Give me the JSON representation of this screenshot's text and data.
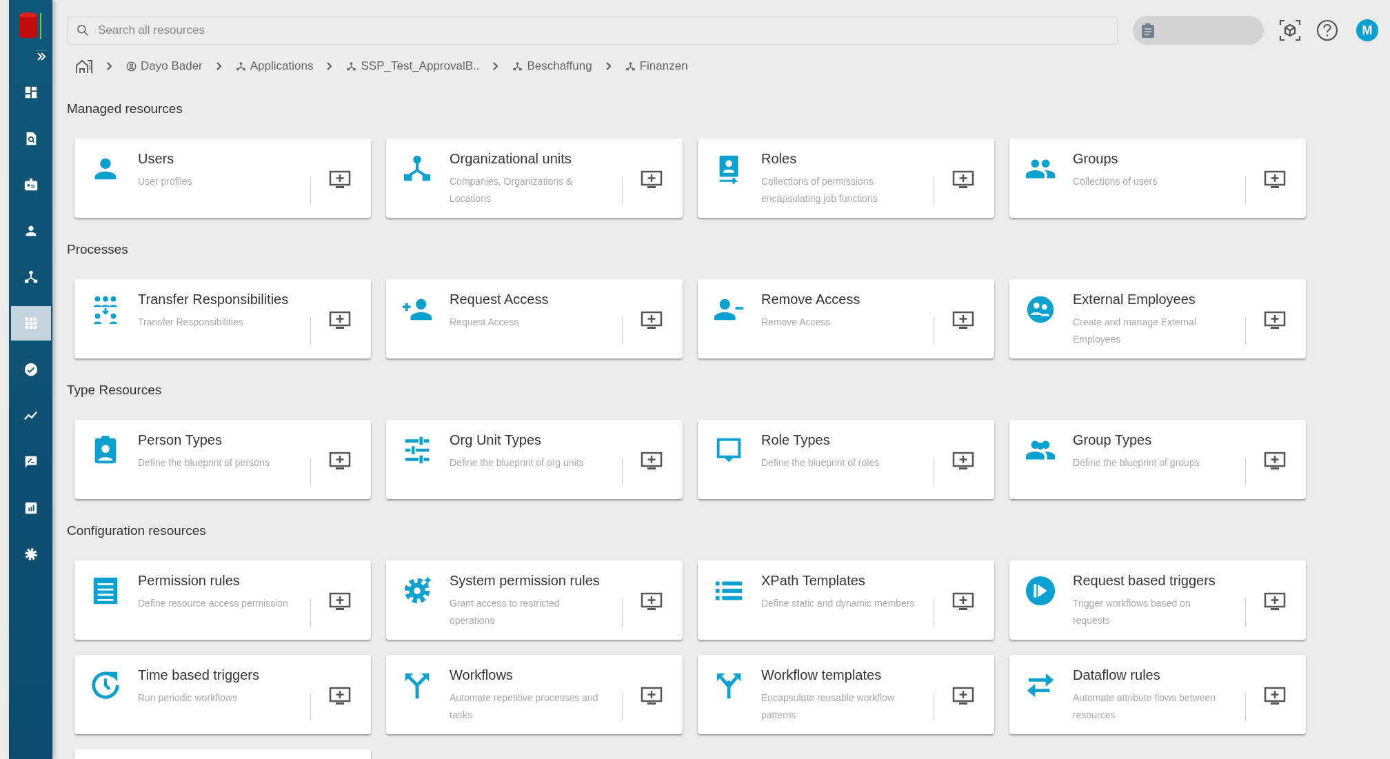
{
  "search": {
    "placeholder": "Search all resources"
  },
  "user": {
    "initial": "M"
  },
  "sidebar": {
    "items": [
      {
        "selected": false
      },
      {
        "selected": false
      },
      {
        "selected": false
      },
      {
        "selected": false
      },
      {
        "selected": false
      },
      {
        "selected": true
      },
      {
        "selected": false
      },
      {
        "selected": false
      },
      {
        "selected": false
      },
      {
        "selected": false
      },
      {
        "selected": false
      }
    ]
  },
  "breadcrumb": [
    {
      "label": "Dayo Bader",
      "kind": "person"
    },
    {
      "label": "Applications",
      "kind": "org"
    },
    {
      "label": "SSP_Test_ApprovalB..",
      "kind": "org"
    },
    {
      "label": "Beschaffung",
      "kind": "org"
    },
    {
      "label": "Finanzen",
      "kind": "org"
    }
  ],
  "sections": [
    {
      "title": "Managed resources",
      "cards": [
        {
          "title": "Users",
          "description": "User profiles"
        },
        {
          "title": "Organizational units",
          "description": "Companies, Organizations & Locations"
        },
        {
          "title": "Roles",
          "description": "Collections of permissions encapsulating job functions"
        },
        {
          "title": "Groups",
          "description": "Collections of users"
        }
      ]
    },
    {
      "title": "Processes",
      "cards": [
        {
          "title": "Transfer Responsibilities",
          "description": "Transfer Responsibilities"
        },
        {
          "title": "Request Access",
          "description": "Request Access"
        },
        {
          "title": "Remove Access",
          "description": "Remove Access"
        },
        {
          "title": "External Employees",
          "description": "Create and manage External Employees"
        }
      ]
    },
    {
      "title": "Type Resources",
      "cards": [
        {
          "title": "Person Types",
          "description": "Define the blueprint of persons"
        },
        {
          "title": "Org Unit Types",
          "description": "Define the blueprint of org units"
        },
        {
          "title": "Role Types",
          "description": "Define the blueprint of roles"
        },
        {
          "title": "Group Types",
          "description": "Define the blueprint of groups"
        }
      ]
    },
    {
      "title": "Configuration resources",
      "cards": [
        {
          "title": "Permission rules",
          "description": "Define resource access permission"
        },
        {
          "title": "System permission rules",
          "description": "Grant access to restricted operations"
        },
        {
          "title": "XPath Templates",
          "description": "Define static and dynamic members"
        },
        {
          "title": "Request based triggers",
          "description": "Trigger workflows based on requests"
        },
        {
          "title": "Time based triggers",
          "description": "Run periodic workflows"
        },
        {
          "title": "Workflows",
          "description": "Automate repetitive processes and tasks"
        },
        {
          "title": "Workflow templates",
          "description": "Encapsulate reusable workflow patterns"
        },
        {
          "title": "Dataflow rules",
          "description": "Automate attribute flows between resources"
        }
      ]
    }
  ]
}
